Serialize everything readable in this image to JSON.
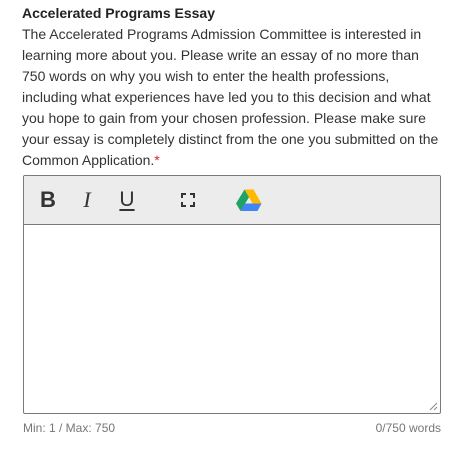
{
  "question": {
    "title": "Accelerated Programs Essay",
    "prompt": "The Accelerated Programs Admission Committee is interested in learning more about you. Please write an essay of no more than 750 words on why you wish to enter the health professions, including what experiences have led you to this decision and what you hope to gain from your chosen profession. Please make sure your essay is completely distinct from the one you submitted on the Common Application.",
    "required_marker": "*"
  },
  "toolbar": {
    "bold_label": "B",
    "italic_label": "I",
    "underline_label": "U",
    "fullscreen_icon": "fullscreen-icon",
    "drive_icon": "google-drive-icon"
  },
  "editor": {
    "value": ""
  },
  "footer": {
    "limits": "Min: 1 / Max: 750",
    "word_count": "0/750 words"
  },
  "colors": {
    "required": "#d9262b",
    "toolbar_bg": "#ececec",
    "border": "#7a7a7a",
    "drive_green": "#1ea362",
    "drive_yellow": "#ffba00",
    "drive_blue": "#4285f4"
  }
}
